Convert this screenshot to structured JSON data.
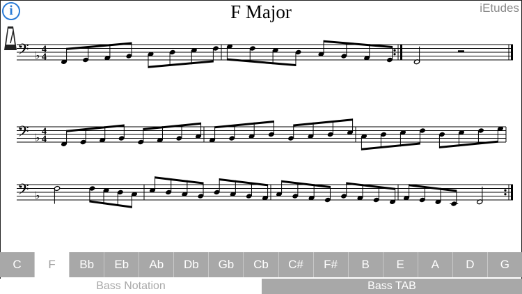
{
  "header": {
    "title": "F Major",
    "brand": "iEtudes",
    "info_label": "i"
  },
  "colors": {
    "accent": "#2a7bd6",
    "bar": "#a8a8a8",
    "bar_text": "#ffffff",
    "notation": "#000000"
  },
  "icons": {
    "info": "info-icon",
    "metronome": "metronome-icon"
  },
  "staff": {
    "clef": "bass",
    "key_signature": "F Major (1 flat)",
    "time_signature": "4/4",
    "systems": [
      {
        "time_signature": true,
        "measures": [
          {
            "notes": [
              "F2",
              "G2",
              "A2",
              "Bb2",
              "C3",
              "D3",
              "E3",
              "F3"
            ]
          },
          {
            "notes": [
              "G3",
              "F3",
              "E3",
              "D3",
              "C3",
              "Bb2",
              "A2",
              "G2"
            ],
            "end_repeat": true
          },
          {
            "notes": [
              "F2"
            ],
            "half_rest": true,
            "final": true
          }
        ]
      },
      {
        "time_signature": true,
        "measures": [
          {
            "notes": [
              "F2",
              "G2",
              "A2",
              "Bb2",
              "G2",
              "A2",
              "Bb2",
              "C3"
            ]
          },
          {
            "notes": [
              "A2",
              "Bb2",
              "C3",
              "D3",
              "Bb2",
              "C3",
              "D3",
              "E3"
            ]
          },
          {
            "notes": [
              "C3",
              "D3",
              "E3",
              "F3",
              "D3",
              "E3",
              "F3",
              "G3"
            ]
          }
        ]
      },
      {
        "time_signature": false,
        "measures": [
          {
            "notes": [
              "F3",
              "F3",
              "E3",
              "D3",
              "C3"
            ],
            "first_half": true
          },
          {
            "notes": [
              "E3",
              "D3",
              "C3",
              "Bb2",
              "D3",
              "C3",
              "Bb2",
              "A2"
            ]
          },
          {
            "notes": [
              "C3",
              "Bb2",
              "A2",
              "G2",
              "Bb2",
              "A2",
              "G2",
              "F2"
            ]
          },
          {
            "notes": [
              "A2",
              "G2",
              "F2",
              "E2",
              "F2"
            ],
            "last_half": true,
            "end_repeat": true
          }
        ]
      }
    ]
  },
  "keys": [
    {
      "label": "C",
      "selected": false
    },
    {
      "label": "F",
      "selected": true
    },
    {
      "label": "Bb",
      "selected": false
    },
    {
      "label": "Eb",
      "selected": false
    },
    {
      "label": "Ab",
      "selected": false
    },
    {
      "label": "Db",
      "selected": false
    },
    {
      "label": "Gb",
      "selected": false
    },
    {
      "label": "Cb",
      "selected": false
    },
    {
      "label": "C#",
      "selected": false
    },
    {
      "label": "F#",
      "selected": false
    },
    {
      "label": "B",
      "selected": false
    },
    {
      "label": "E",
      "selected": false
    },
    {
      "label": "A",
      "selected": false
    },
    {
      "label": "D",
      "selected": false
    },
    {
      "label": "G",
      "selected": false
    }
  ],
  "modes": {
    "notation": "Bass Notation",
    "tab": "Bass TAB"
  }
}
